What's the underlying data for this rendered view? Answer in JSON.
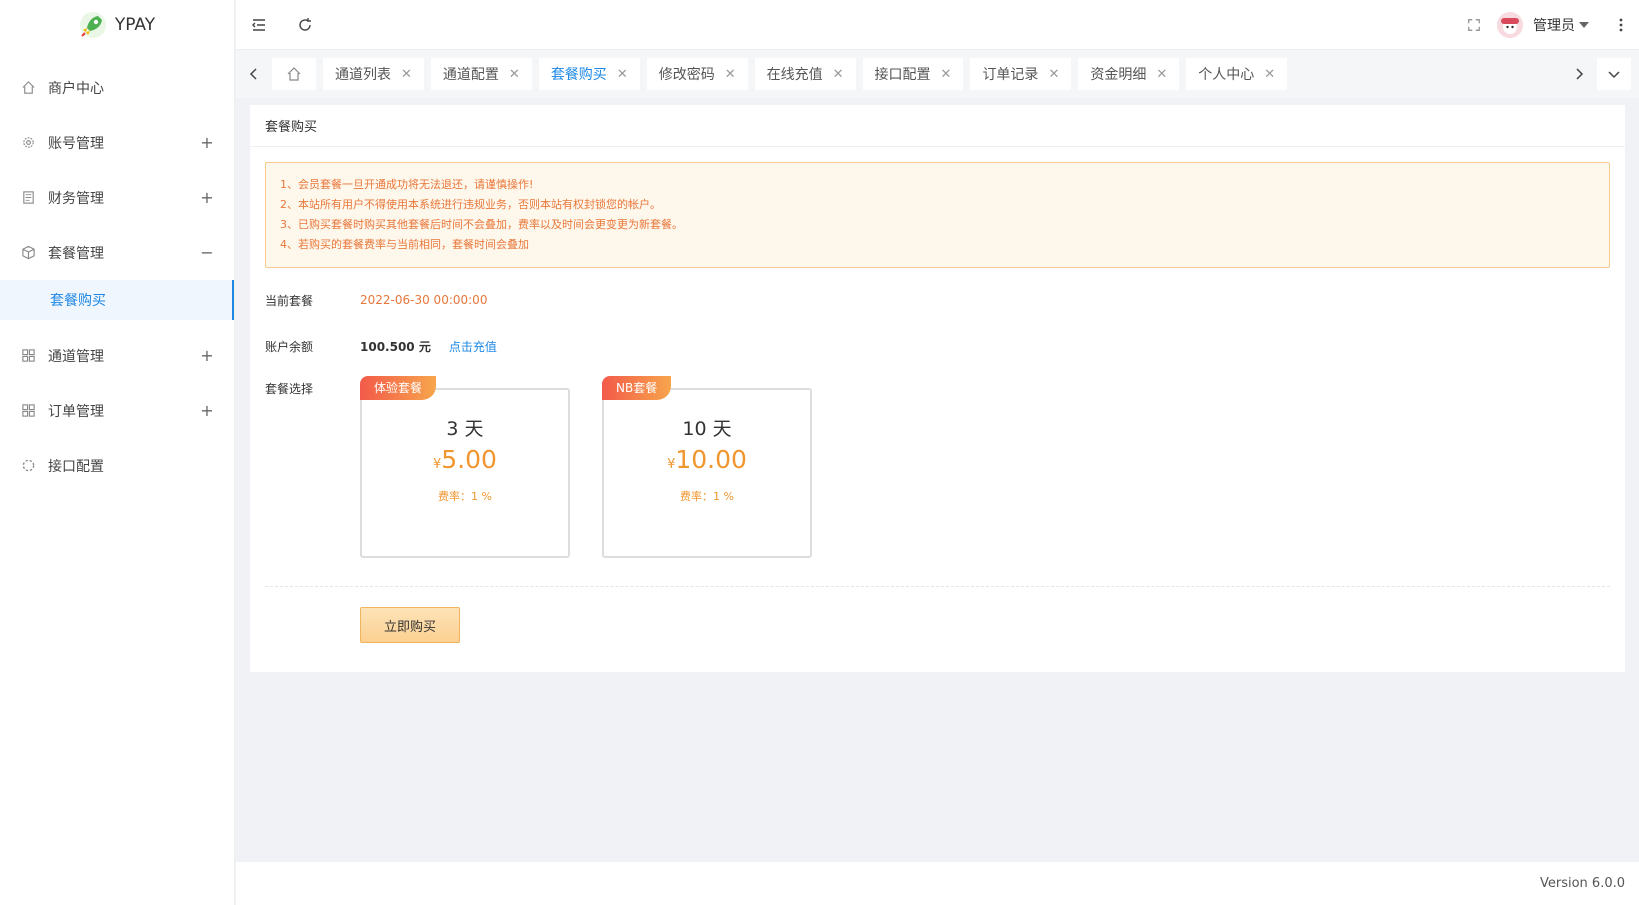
{
  "app": {
    "name": "YPAY",
    "version": "Version 6.0.0"
  },
  "sidebar": {
    "items": [
      {
        "label": "商户中心",
        "toggle": ""
      },
      {
        "label": "账号管理",
        "toggle": "+"
      },
      {
        "label": "财务管理",
        "toggle": "+"
      },
      {
        "label": "套餐管理",
        "toggle": "−"
      },
      {
        "label": "通道管理",
        "toggle": "+"
      },
      {
        "label": "订单管理",
        "toggle": "+"
      },
      {
        "label": "接口配置",
        "toggle": ""
      }
    ],
    "sub_active": "套餐购买"
  },
  "header": {
    "user": "管理员"
  },
  "tabs": [
    {
      "label": "通道列表"
    },
    {
      "label": "通道配置"
    },
    {
      "label": "套餐购买"
    },
    {
      "label": "修改密码"
    },
    {
      "label": "在线充值"
    },
    {
      "label": "接口配置"
    },
    {
      "label": "订单记录"
    },
    {
      "label": "资金明细"
    },
    {
      "label": "个人中心"
    }
  ],
  "active_tab": "套餐购买",
  "page": {
    "title": "套餐购买",
    "notices": [
      "1、会员套餐一旦开通成功将无法退还，请谨慎操作!",
      "2、本站所有用户不得使用本系统进行违规业务，否则本站有权封锁您的帐户。",
      "3、已购买套餐时购买其他套餐后时间不会叠加，费率以及时间会更变更为新套餐。",
      "4、若购买的套餐费率与当前相同，套餐时间会叠加"
    ],
    "current_label": "当前套餐",
    "current_value": "2022-06-30 00:00:00",
    "balance_label": "账户余额",
    "balance_value": "100.500 元",
    "recharge_link": "点击充值",
    "package_label": "套餐选择",
    "packages": [
      {
        "tag": "体验套餐",
        "days": "3 天",
        "currency": "¥",
        "price": "5.00",
        "rate": "费率：1 %"
      },
      {
        "tag": "NB套餐",
        "days": "10 天",
        "currency": "¥",
        "price": "10.00",
        "rate": "费率：1 %"
      }
    ],
    "buy_button": "立即购买"
  },
  "colors": {
    "accent": "#1e88e5",
    "warning": "#e8773a",
    "price": "#f0962e"
  }
}
